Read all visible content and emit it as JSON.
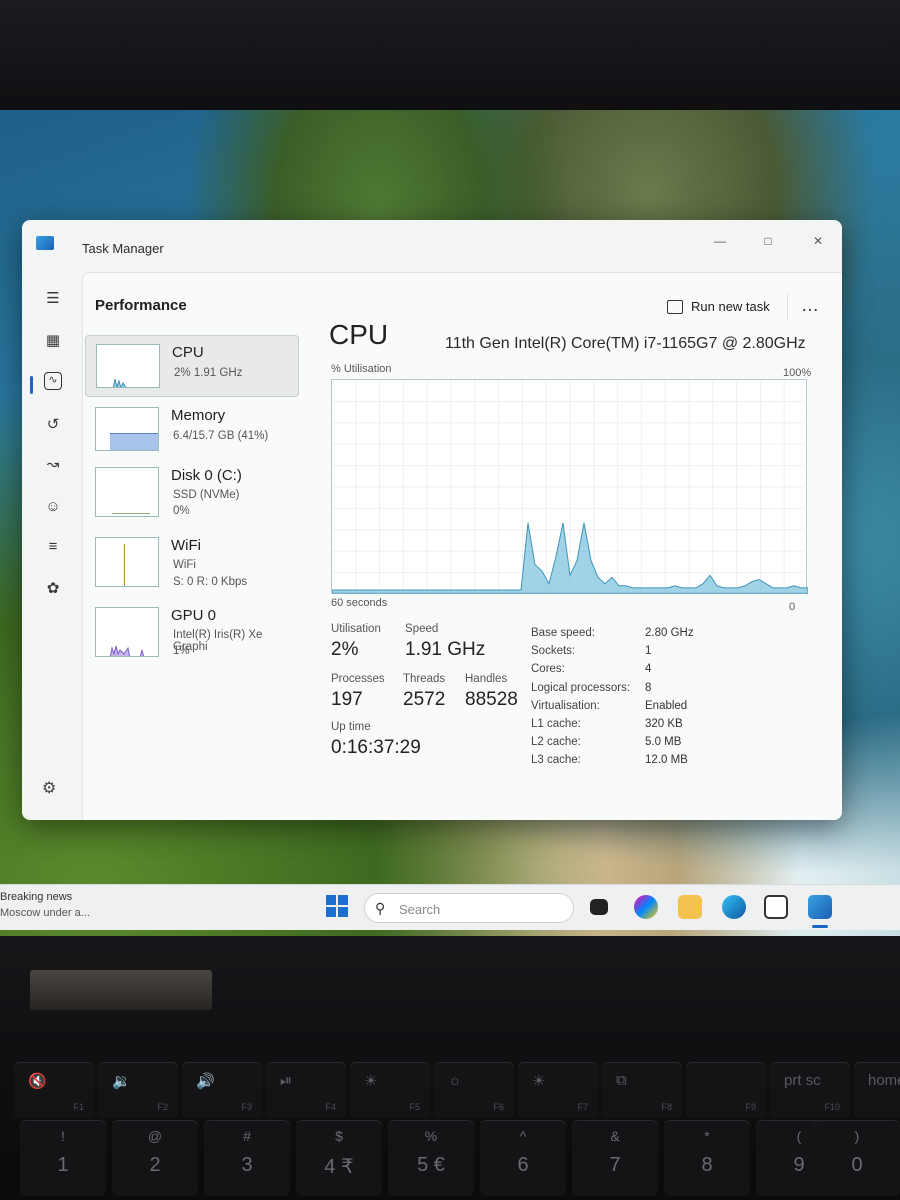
{
  "window": {
    "title": "Task Manager",
    "page_title": "Performance",
    "run_new_task_label": "Run new task",
    "more_label": "…"
  },
  "devices": [
    {
      "name": "CPU",
      "sub1": "2% 1.91 GHz",
      "sub2": ""
    },
    {
      "name": "Memory",
      "sub1": "6.4/15.7 GB (41%)",
      "sub2": ""
    },
    {
      "name": "Disk 0 (C:)",
      "sub1": "SSD (NVMe)",
      "sub2": "0%"
    },
    {
      "name": "WiFi",
      "sub1": "WiFi",
      "sub2": "S: 0 R: 0 Kbps"
    },
    {
      "name": "GPU 0",
      "sub1": "Intel(R) Iris(R) Xe Graphi",
      "sub2": "1%"
    }
  ],
  "cpu_panel": {
    "heading": "CPU",
    "model": "11th Gen Intel(R) Core(TM) i7-1165G7 @ 2.80GHz",
    "graph_label": "% Utilisation",
    "graph_max": "100%",
    "graph_span": "60 seconds",
    "graph_min": "0",
    "stats": {
      "utilisation_label": "Utilisation",
      "utilisation": "2%",
      "speed_label": "Speed",
      "speed": "1.91 GHz",
      "processes_label": "Processes",
      "processes": "197",
      "threads_label": "Threads",
      "threads": "2572",
      "handles_label": "Handles",
      "handles": "88528",
      "uptime_label": "Up time",
      "uptime": "0:16:37:29"
    },
    "specs": [
      {
        "label": "Base speed:",
        "value": "2.80 GHz"
      },
      {
        "label": "Sockets:",
        "value": "1"
      },
      {
        "label": "Cores:",
        "value": "4"
      },
      {
        "label": "Logical processors:",
        "value": "8"
      },
      {
        "label": "Virtualisation:",
        "value": "Enabled"
      },
      {
        "label": "L1 cache:",
        "value": "320 KB"
      },
      {
        "label": "L2 cache:",
        "value": "5.0 MB"
      },
      {
        "label": "L3 cache:",
        "value": "12.0 MB"
      }
    ]
  },
  "taskbar": {
    "news_line1": "Breaking news",
    "news_line2": "Moscow under a...",
    "search_placeholder": "Search"
  },
  "keyboard": {
    "fn_row": [
      {
        "top": "🔇",
        "fn": "F1"
      },
      {
        "top": "🔉",
        "fn": "F2"
      },
      {
        "top": "🔊",
        "fn": "F3"
      },
      {
        "top": "⏯",
        "fn": "F4"
      },
      {
        "top": "☀",
        "fn": "F5"
      },
      {
        "top": "☼",
        "fn": "F6"
      },
      {
        "top": "☀",
        "fn": "F7"
      },
      {
        "top": "⧉",
        "fn": "F8"
      },
      {
        "top": "",
        "fn": "F9"
      },
      {
        "top": "prt sc",
        "fn": "F10"
      },
      {
        "top": "home",
        "fn": ""
      }
    ],
    "num_row": [
      {
        "sym": "!",
        "num": "1"
      },
      {
        "sym": "@",
        "num": "2"
      },
      {
        "sym": "#",
        "num": "3"
      },
      {
        "sym": "$",
        "num": "4 ₹"
      },
      {
        "sym": "%",
        "num": "5 €"
      },
      {
        "sym": "^",
        "num": "6"
      },
      {
        "sym": "&",
        "num": "7"
      },
      {
        "sym": "*",
        "num": "8"
      },
      {
        "sym": "(",
        "num": "9"
      },
      {
        "sym": ")",
        "num": "0"
      }
    ]
  },
  "chart_data": {
    "type": "area",
    "x_label": "60 seconds",
    "ylim": [
      0,
      100
    ],
    "grid": true,
    "values": [
      0,
      0,
      0,
      0,
      0,
      0,
      0,
      0,
      0,
      0,
      0,
      0,
      0,
      0,
      0,
      0,
      0,
      0,
      0,
      0,
      0,
      0,
      0,
      0,
      0,
      0,
      0,
      0,
      32,
      12,
      9,
      3,
      16,
      32,
      7,
      14,
      32,
      14,
      6,
      3,
      6,
      2,
      2,
      1,
      1,
      1,
      1,
      1,
      1,
      2,
      1,
      1,
      1,
      3,
      7,
      2,
      1,
      1,
      1,
      2,
      4,
      5,
      3,
      1,
      1,
      1,
      2,
      1,
      1
    ],
    "color": "#7fc4dc"
  }
}
